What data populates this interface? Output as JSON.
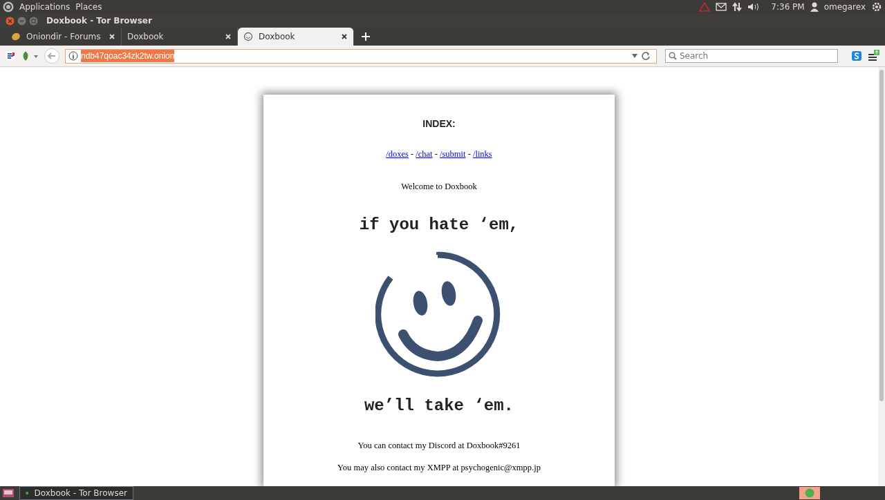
{
  "top_panel": {
    "menus": [
      "Applications",
      "Places"
    ],
    "clock": "7:36 PM",
    "user": "omegarex"
  },
  "window": {
    "title": "Doxbook - Tor Browser"
  },
  "tabs": [
    {
      "label": "Oniondir - Forums",
      "selected": false,
      "kind": "forum"
    },
    {
      "label": "Doxbook",
      "selected": false,
      "kind": "blank"
    },
    {
      "label": "Doxbook",
      "selected": true,
      "kind": "smiley"
    }
  ],
  "address_bar": {
    "value": "ndb47qoac34zk2tw.onion",
    "highlighted": true
  },
  "search": {
    "placeholder": "Search"
  },
  "page": {
    "heading": "INDEX:",
    "links": [
      "/doxes",
      "/chat",
      "/submit",
      "/links"
    ],
    "separator": "-",
    "welcome": "Welcome to Doxbook",
    "slogan_top": "if you hate ‘em,",
    "slogan_bottom": "we’ll take ‘em.",
    "contacts": [
      "You can contact my Discord at Doxbook#9261",
      "You may also contact my XMPP at psychogenic@xmpp.jp"
    ]
  },
  "taskbar": {
    "task": "Doxbook - Tor Browser"
  }
}
